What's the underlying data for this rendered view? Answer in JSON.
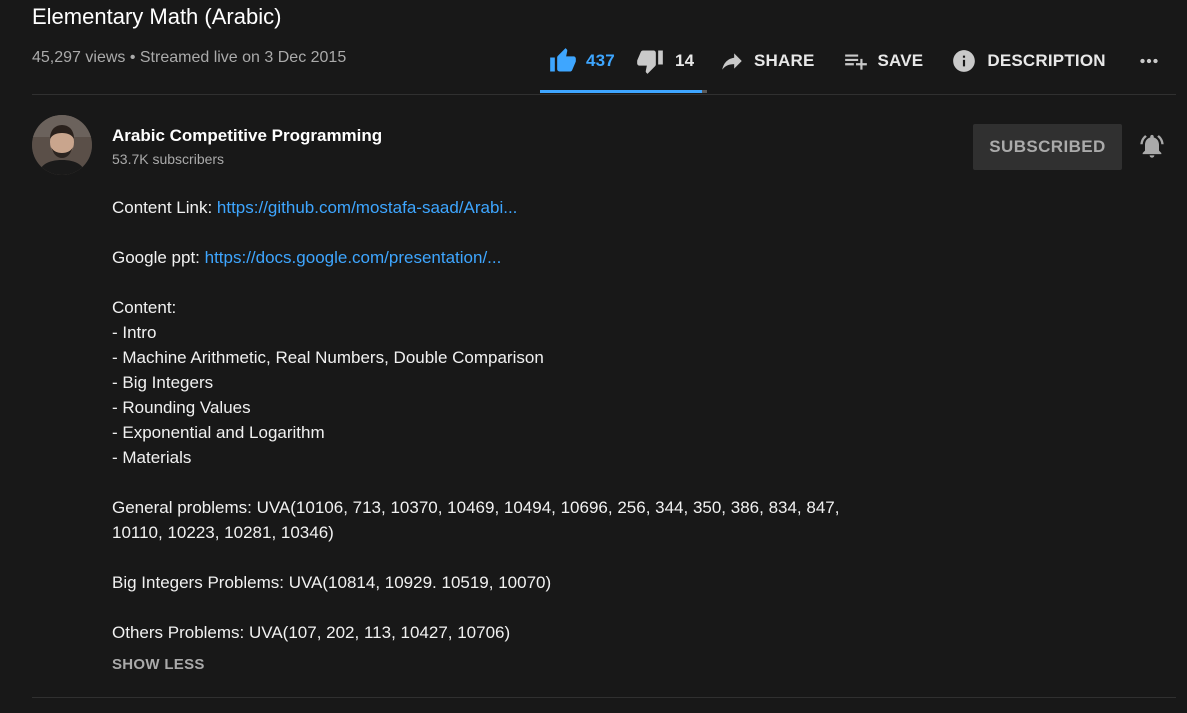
{
  "video": {
    "title": "Elementary Math (Arabic)",
    "meta": "45,297 views • Streamed live on 3 Dec 2015"
  },
  "actions": {
    "like_count": "437",
    "dislike_count": "14",
    "share_label": "SHARE",
    "save_label": "SAVE",
    "description_label": "DESCRIPTION",
    "like_ratio": 0.969
  },
  "channel": {
    "name": "Arabic Competitive Programming",
    "subscribers": "53.7K subscribers",
    "subscribe_label": "SUBSCRIBED"
  },
  "description": {
    "content_link_label": "Content Link: ",
    "content_link_url": "https://github.com/mostafa-saad/Arabi...",
    "ppt_label": "Google ppt: ",
    "ppt_url": "https://docs.google.com/presentation/...",
    "content_heading": "Content:",
    "content_items": [
      "- Intro",
      "- Machine Arithmetic, Real Numbers, Double Comparison",
      "- Big Integers",
      "- Rounding Values",
      "- Exponential and Logarithm",
      "- Materials"
    ],
    "general_problems": "General problems: UVA(10106, 713, 10370, 10469, 10494, 10696, 256, 344, 350, 386, 834, 847, 10110, 10223, 10281, 10346)",
    "big_integer_problems": "Big Integers Problems: UVA(10814, 10929. 10519, 10070)",
    "other_problems": "Others Problems: UVA(107, 202, 113, 10427, 10706)",
    "show_less_label": "SHOW LESS"
  },
  "colors": {
    "background": "#181818",
    "accent": "#3ea6ff",
    "muted_text": "#aaaaaa",
    "subscribed_button_bg": "#303030"
  },
  "icons": [
    "thumb-up-icon",
    "thumb-down-icon",
    "share-arrow-icon",
    "playlist-add-icon",
    "info-icon",
    "more-horiz-icon",
    "bell-icon"
  ]
}
